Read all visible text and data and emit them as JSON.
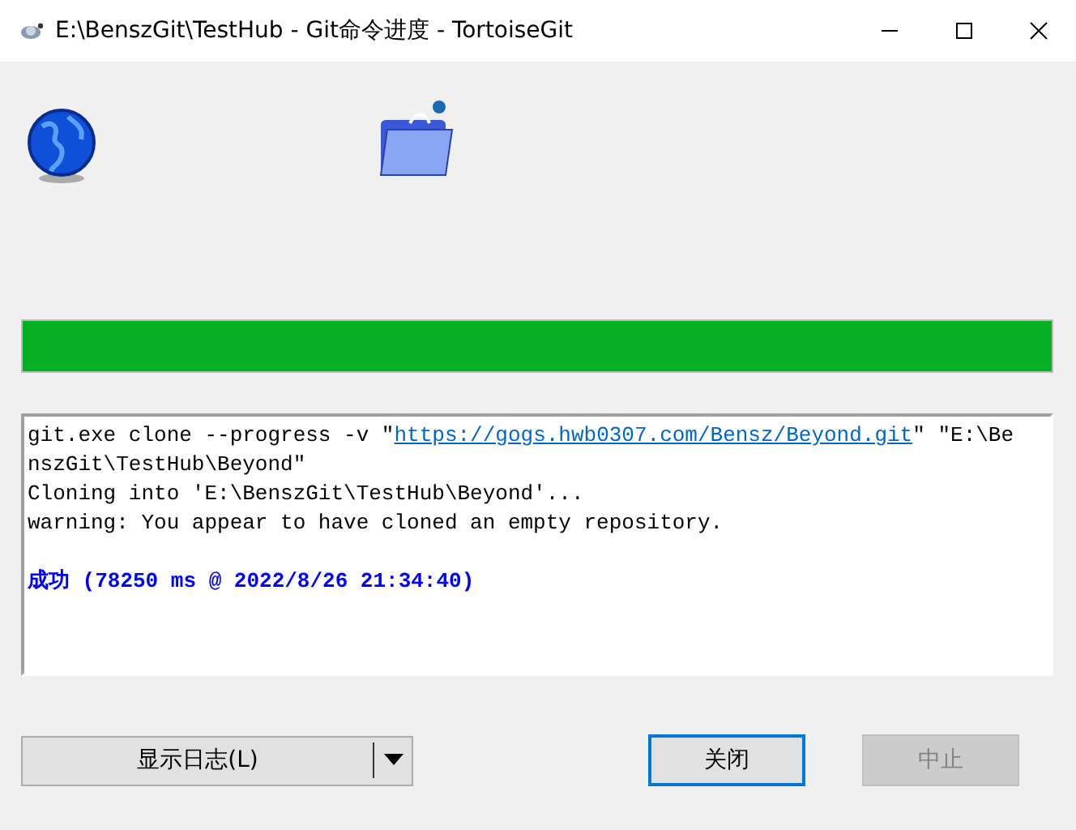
{
  "window": {
    "title": "E:\\BenszGit\\TestHub - Git命令进度 - TortoiseGit"
  },
  "progress": {
    "level": 1.0
  },
  "log": [
    {
      "kind": "command",
      "before": "git.exe clone --progress -v \"",
      "link": "https://gogs.hwb0307.com/Bensz/Beyond.git",
      "after": "\" \"E:\\BenszGit\\TestHub\\Beyond\""
    },
    {
      "kind": "text",
      "text": "Cloning into 'E:\\BenszGit\\TestHub\\Beyond'..."
    },
    {
      "kind": "text",
      "text": "warning: You appear to have cloned an empty repository."
    },
    {
      "kind": "blank"
    },
    {
      "kind": "success",
      "text": "成功 (78250 ms @ 2022/8/26 21:34:40)"
    }
  ],
  "buttons": [
    {
      "kind": "split",
      "label": "显示日志(L)"
    },
    {
      "kind": "plain",
      "label": "关闭",
      "disabled": false,
      "default": true
    },
    {
      "kind": "plain",
      "label": "中止",
      "disabled": true,
      "default": false
    }
  ]
}
